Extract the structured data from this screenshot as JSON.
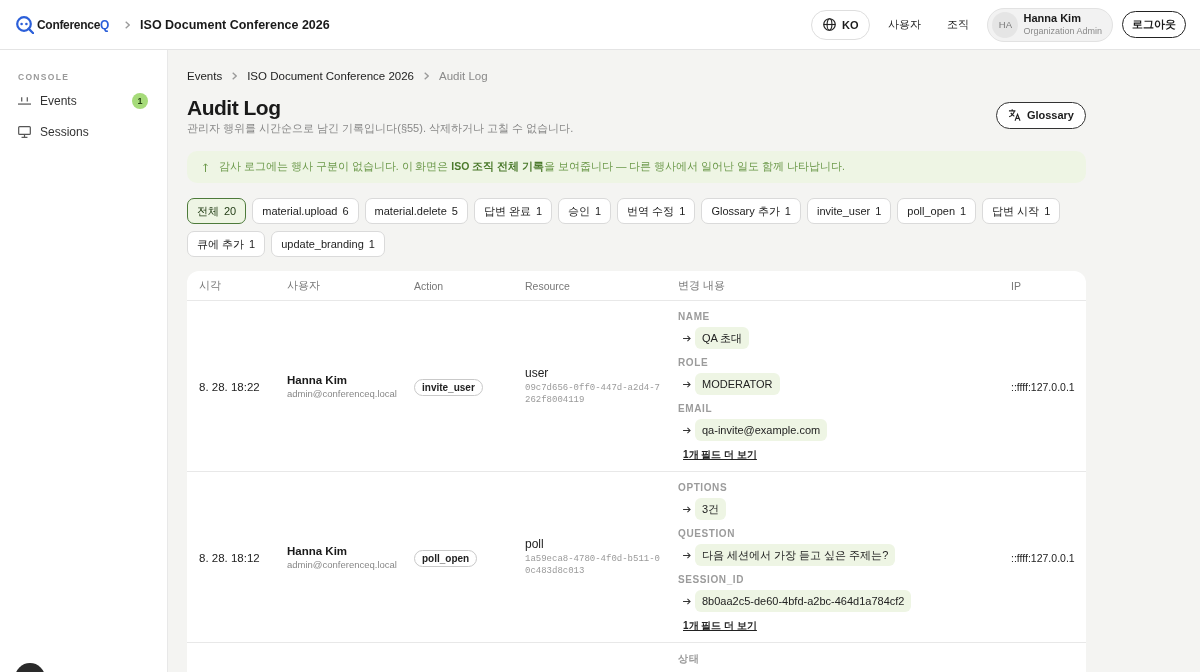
{
  "header": {
    "brand": {
      "name": "Conference",
      "accent": "Q"
    },
    "event_title": "ISO Document Conference 2026",
    "language": "KO",
    "nav": [
      "사용자",
      "조직"
    ],
    "user": {
      "initials": "HA",
      "name": "Hanna Kim",
      "role": "Organization Admin"
    },
    "logout": "로그아웃"
  },
  "sidebar": {
    "section": "CONSOLE",
    "items": [
      {
        "kind": "events",
        "label": "Events",
        "badge": "1",
        "selected": false
      },
      {
        "kind": "sessions",
        "label": "Sessions",
        "selected": false
      }
    ]
  },
  "breadcrumb": [
    {
      "label": "Events",
      "current": false
    },
    {
      "label": "ISO Document Conference 2026",
      "current": false
    },
    {
      "label": "Audit Log",
      "current": true
    }
  ],
  "page": {
    "title": "Audit Log",
    "subtitle": "관리자 행위를 시간순으로 남긴 기록입니다(§55). 삭제하거나 고칠 수 없습니다.",
    "glossary_button": "Glossary"
  },
  "notice": {
    "text": "감사 로그에는 행사 구분이 없습니다. 이 화면은 **ISO 조직 전체 기록**을 보여줍니다 — 다른 행사에서 일어난 일도 함께 나타납니다."
  },
  "filters": [
    {
      "label": "전체",
      "count": "20",
      "selected": true
    },
    {
      "label": "material.upload",
      "count": "6",
      "selected": false
    },
    {
      "label": "material.delete",
      "count": "5",
      "selected": false
    },
    {
      "label": "답변 완료",
      "count": "1",
      "selected": false
    },
    {
      "label": "승인",
      "count": "1",
      "selected": false
    },
    {
      "label": "번역 수정",
      "count": "1",
      "selected": false
    },
    {
      "label": "Glossary 추가",
      "count": "1",
      "selected": false
    },
    {
      "label": "invite_user",
      "count": "1",
      "selected": false
    },
    {
      "label": "poll_open",
      "count": "1",
      "selected": false
    },
    {
      "label": "답변 시작",
      "count": "1",
      "selected": false
    },
    {
      "label": "큐에 추가",
      "count": "1",
      "selected": false
    },
    {
      "label": "update_branding",
      "count": "1",
      "selected": false
    }
  ],
  "table": {
    "columns": [
      "시각",
      "사용자",
      "Action",
      "Resource",
      "변경 내용",
      "IP"
    ],
    "rows": [
      {
        "time": "8. 28. 18:22",
        "user": {
          "name": "Hanna Kim",
          "email": "admin@conferenceq.local"
        },
        "action": "invite_user",
        "resource": {
          "type": "user",
          "id": "09c7d656-0ff0-447d-a2d4-7262f8004119"
        },
        "changes": [
          {
            "field": "NAME",
            "value": "QA 초대"
          },
          {
            "field": "ROLE",
            "value": "MODERATOR"
          },
          {
            "field": "EMAIL",
            "value": "qa-invite@example.com"
          }
        ],
        "more": "1개 필드 더 보기",
        "ip": "::ffff:127.0.0.1"
      },
      {
        "time": "8. 28. 18:12",
        "user": {
          "name": "Hanna Kim",
          "email": "admin@conferenceq.local"
        },
        "action": "poll_open",
        "resource": {
          "type": "poll",
          "id": "1a59eca8-4780-4f0d-b511-00c483d8c013"
        },
        "changes": [
          {
            "field": "OPTIONS",
            "value": "3건"
          },
          {
            "field": "QUESTION",
            "value": "다음 세션에서 가장 듣고 싶은 주제는?"
          },
          {
            "field": "SESSION_ID",
            "value": "8b0aa2c5-de60-4bfd-a2bc-464d1a784cf2"
          }
        ],
        "more": "1개 필드 더 보기",
        "ip": "::ffff:127.0.0.1"
      },
      {
        "changes": [
          {
            "field": "상태"
          }
        ]
      }
    ]
  }
}
